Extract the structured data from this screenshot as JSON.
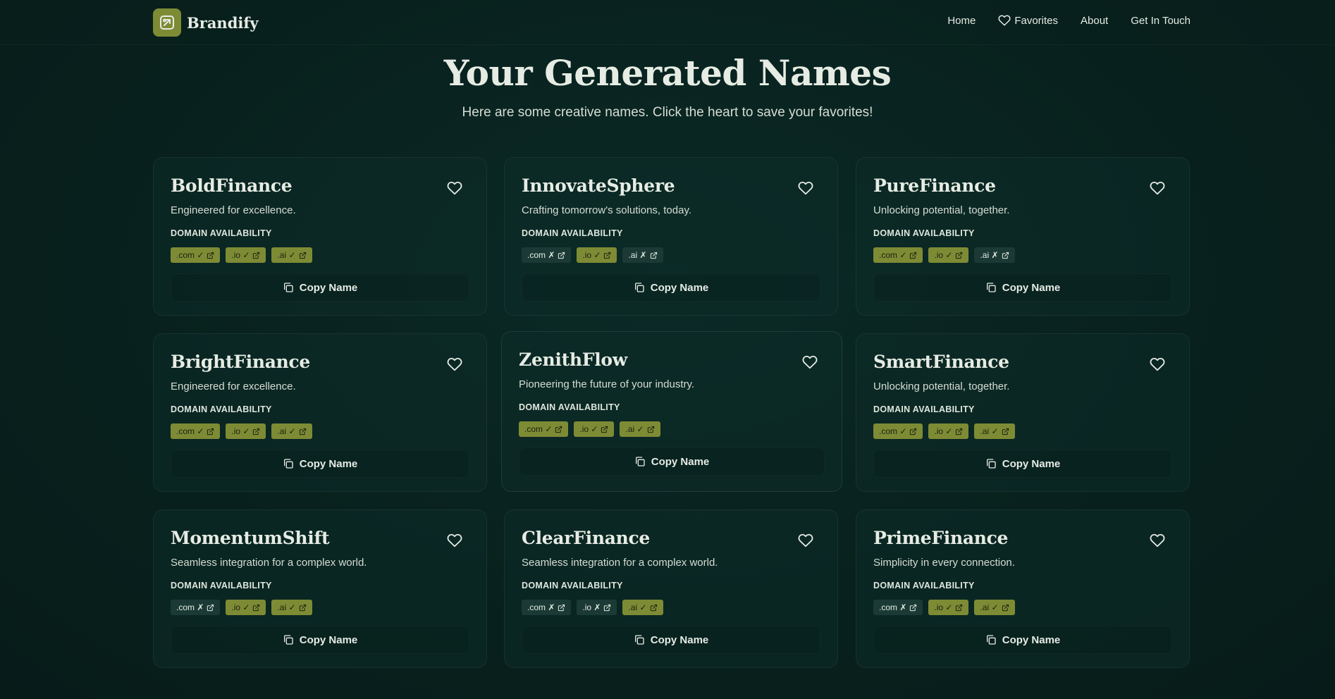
{
  "brand": {
    "name": "Brandify",
    "logo_icon": "brand-logo-icon",
    "accent": "#7e8b35"
  },
  "nav": {
    "home": "Home",
    "favorites": "Favorites",
    "about": "About",
    "contact": "Get In Touch"
  },
  "hero": {
    "title": "Your Generated Names",
    "subtitle": "Here are some creative names. Click the heart to save your favorites!"
  },
  "labels": {
    "domain_availability": "DOMAIN AVAILABILITY",
    "copy": "Copy Name"
  },
  "cards": [
    {
      "name": "BoldFinance",
      "tagline": "Engineered for excellence.",
      "domains": [
        {
          "label": ".com ✓",
          "available": true
        },
        {
          "label": ".io ✓",
          "available": true
        },
        {
          "label": ".ai ✓",
          "available": true
        }
      ]
    },
    {
      "name": "InnovateSphere",
      "tagline": "Crafting tomorrow's solutions, today.",
      "domains": [
        {
          "label": ".com ✗",
          "available": false
        },
        {
          "label": ".io ✓",
          "available": true
        },
        {
          "label": ".ai ✗",
          "available": false
        }
      ]
    },
    {
      "name": "PureFinance",
      "tagline": "Unlocking potential, together.",
      "domains": [
        {
          "label": ".com ✓",
          "available": true
        },
        {
          "label": ".io ✓",
          "available": true
        },
        {
          "label": ".ai ✗",
          "available": false
        }
      ]
    },
    {
      "name": "BrightFinance",
      "tagline": "Engineered for excellence.",
      "domains": [
        {
          "label": ".com ✓",
          "available": true
        },
        {
          "label": ".io ✓",
          "available": true
        },
        {
          "label": ".ai ✓",
          "available": true
        }
      ]
    },
    {
      "name": "ZenithFlow",
      "tagline": "Pioneering the future of your industry.",
      "domains": [
        {
          "label": ".com ✓",
          "available": true
        },
        {
          "label": ".io ✓",
          "available": true
        },
        {
          "label": ".ai ✓",
          "available": true
        }
      ]
    },
    {
      "name": "SmartFinance",
      "tagline": "Unlocking potential, together.",
      "domains": [
        {
          "label": ".com ✓",
          "available": true
        },
        {
          "label": ".io ✓",
          "available": true
        },
        {
          "label": ".ai ✓",
          "available": true
        }
      ]
    },
    {
      "name": "MomentumShift",
      "tagline": "Seamless integration for a complex world.",
      "domains": [
        {
          "label": ".com ✗",
          "available": false
        },
        {
          "label": ".io ✓",
          "available": true
        },
        {
          "label": ".ai ✓",
          "available": true
        }
      ]
    },
    {
      "name": "ClearFinance",
      "tagline": "Seamless integration for a complex world.",
      "domains": [
        {
          "label": ".com ✗",
          "available": false
        },
        {
          "label": ".io ✗",
          "available": false
        },
        {
          "label": ".ai ✓",
          "available": true
        }
      ]
    },
    {
      "name": "PrimeFinance",
      "tagline": "Simplicity in every connection.",
      "domains": [
        {
          "label": ".com ✗",
          "available": false
        },
        {
          "label": ".io ✓",
          "available": true
        },
        {
          "label": ".ai ✓",
          "available": true
        }
      ]
    }
  ]
}
